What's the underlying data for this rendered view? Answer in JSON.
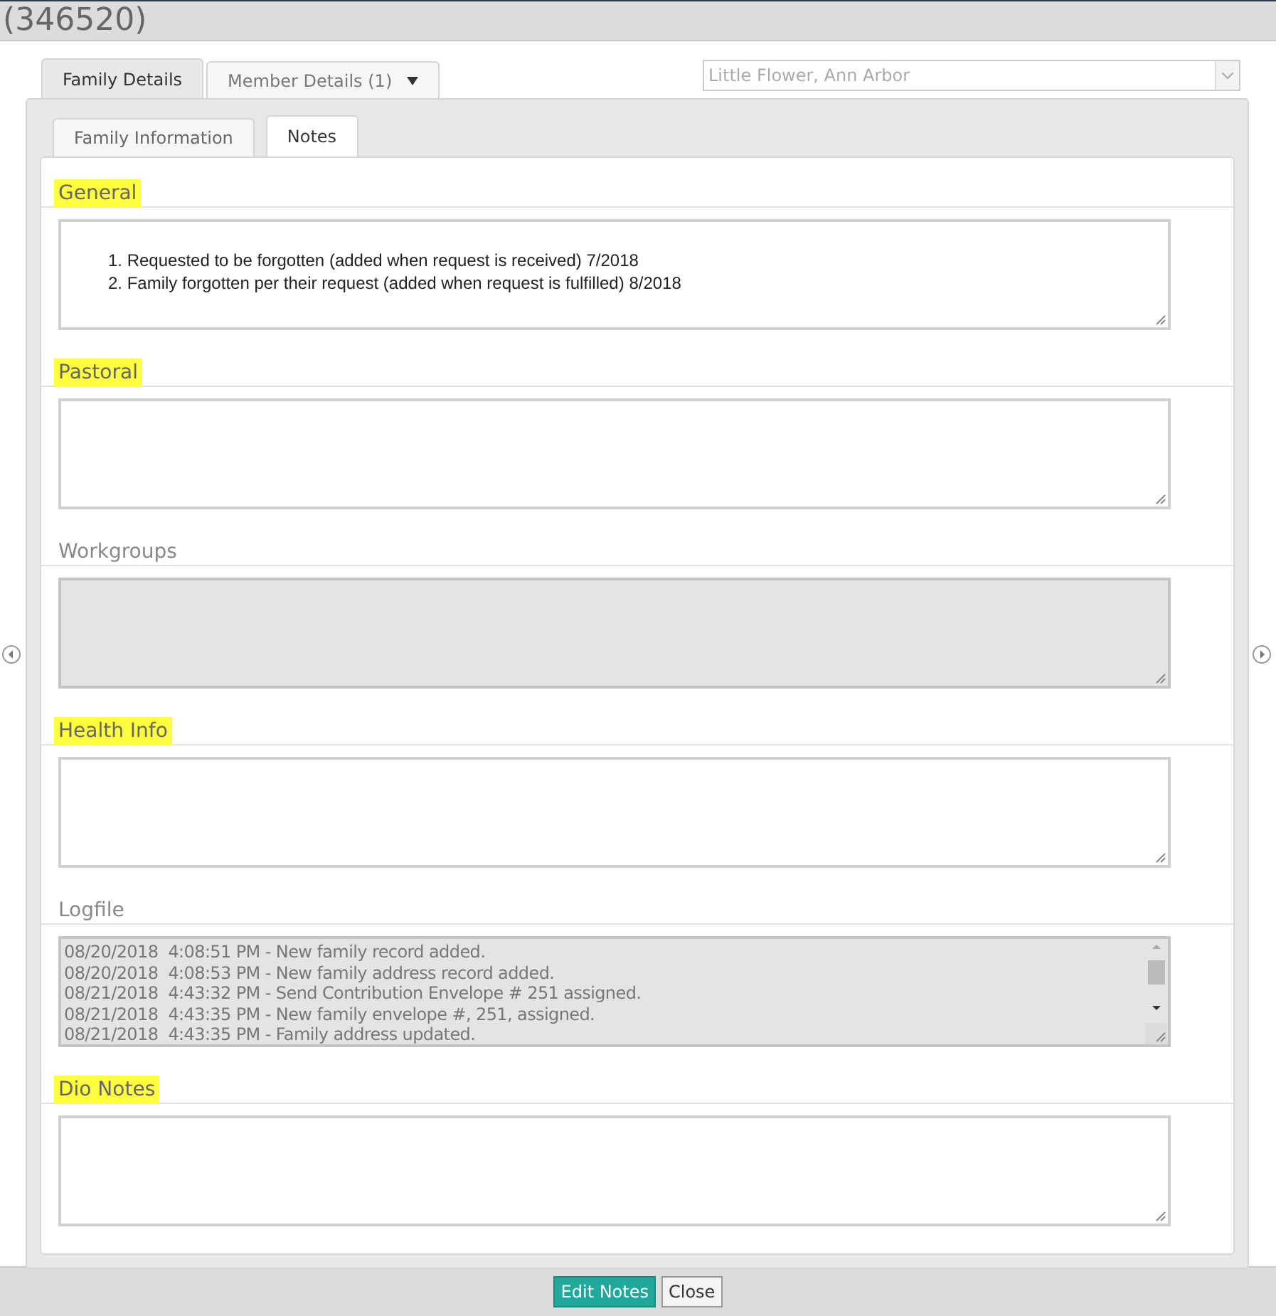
{
  "window": {
    "title": "(346520)"
  },
  "outer_tabs": [
    {
      "label": "Family Details",
      "selected": true,
      "dropdown": false
    },
    {
      "label": "Member Details (1)",
      "selected": false,
      "dropdown": true
    }
  ],
  "parish_select": {
    "value": "Little Flower, Ann Arbor",
    "disabled": true
  },
  "inner_tabs": [
    {
      "label": "Family Information",
      "selected": false
    },
    {
      "label": "Notes",
      "selected": true
    }
  ],
  "sections": [
    {
      "label": "General",
      "highlighted": true,
      "readonly": false,
      "kind": "text",
      "lines": [
        "1. Requested to be forgotten (added when request is received) 7/2018",
        "2. Family forgotten per their request (added when request is fulfilled) 8/2018"
      ]
    },
    {
      "label": "Pastoral",
      "highlighted": true,
      "readonly": false,
      "kind": "text"
    },
    {
      "label": "Workgroups",
      "highlighted": false,
      "readonly": true,
      "kind": "text"
    },
    {
      "label": "Health Info",
      "highlighted": true,
      "readonly": false,
      "kind": "text"
    },
    {
      "label": "Logfile",
      "highlighted": false,
      "readonly": true,
      "kind": "log",
      "lines": [
        "08/20/2018  4:08:51 PM - New family record added.",
        "08/20/2018  4:08:53 PM - New family address record added.",
        "08/21/2018  4:43:32 PM - Send Contribution Envelope # 251 assigned.",
        "08/21/2018  4:43:35 PM - New family envelope #, 251, assigned.",
        "08/21/2018  4:43:35 PM - Family address updated."
      ]
    },
    {
      "label": "Dio Notes",
      "highlighted": true,
      "readonly": false,
      "kind": "text"
    }
  ],
  "buttons": [
    {
      "label": "Edit Notes",
      "kind": "primary"
    },
    {
      "label": "Close",
      "kind": "secondary"
    }
  ]
}
